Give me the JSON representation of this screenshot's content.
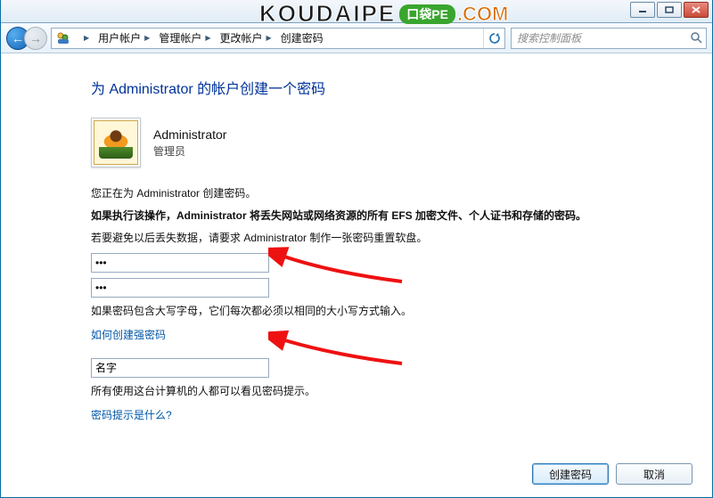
{
  "window": {
    "min_tip": "最小化",
    "max_tip": "最大化",
    "close_tip": "关闭"
  },
  "nav": {
    "back_tip": "后退",
    "forward_tip": "前进",
    "refresh_tip": "刷新"
  },
  "breadcrumbs": {
    "icon": "user-accounts-icon",
    "items": [
      "用户帐户",
      "管理帐户",
      "更改帐户",
      "创建密码"
    ]
  },
  "search": {
    "placeholder": "搜索控制面板"
  },
  "page": {
    "title": "为 Administrator 的帐户创建一个密码",
    "user": {
      "name": "Administrator",
      "role": "管理员"
    },
    "line1": "您正在为 Administrator 创建密码。",
    "line2_bold": "如果执行该操作，Administrator 将丢失网站或网络资源的所有 EFS 加密文件、个人证书和存储的密码。",
    "line3": "若要避免以后丢失数据，请要求 Administrator 制作一张密码重置软盘。",
    "pw1_value": "•••",
    "pw2_value": "•••",
    "caps_note": "如果密码包含大写字母，它们每次都必须以相同的大小写方式输入。",
    "link_strong_pw": "如何创建强密码",
    "hint_value": "名字",
    "hint_note": "所有使用这台计算机的人都可以看见密码提示。",
    "link_hint": "密码提示是什么?"
  },
  "buttons": {
    "create": "创建密码",
    "cancel": "取消"
  },
  "watermark": {
    "brand": "KOUDAIPE",
    "badge": "口袋PE",
    "suffix": ".COM"
  }
}
